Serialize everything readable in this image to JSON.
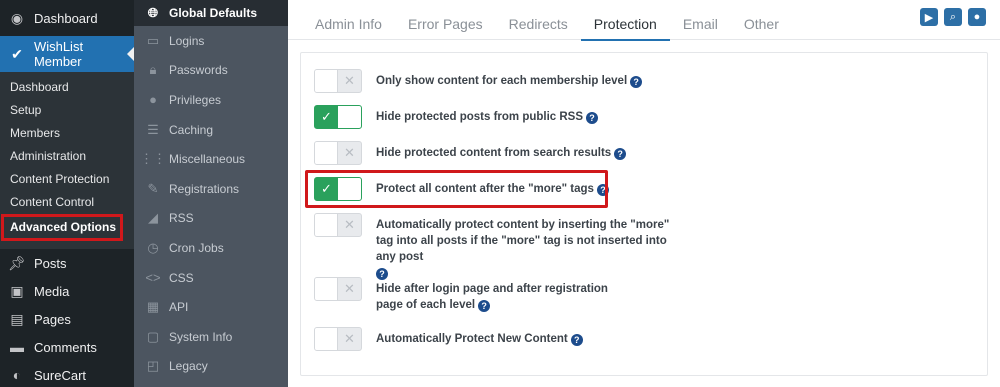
{
  "wp_menu": {
    "dashboard": "Dashboard",
    "wishlist": "WishList Member",
    "submenu": [
      "Dashboard",
      "Setup",
      "Members",
      "Administration",
      "Content Protection",
      "Content Control",
      "Advanced Options"
    ],
    "current_submenu": "Advanced Options",
    "items": [
      {
        "label": "Posts",
        "icon": "pin-icon"
      },
      {
        "label": "Media",
        "icon": "media-icon"
      },
      {
        "label": "Pages",
        "icon": "page-icon"
      },
      {
        "label": "Comments",
        "icon": "comment-icon"
      },
      {
        "label": "SureCart",
        "icon": "surecart-icon"
      }
    ]
  },
  "wl_menu": {
    "items": [
      {
        "label": "Global Defaults",
        "icon": "globe-icon"
      },
      {
        "label": "Logins",
        "icon": "login-icon"
      },
      {
        "label": "Passwords",
        "icon": "lock-icon"
      },
      {
        "label": "Privileges",
        "icon": "user-icon"
      },
      {
        "label": "Caching",
        "icon": "caching-icon"
      },
      {
        "label": "Miscellaneous",
        "icon": "grid-icon"
      },
      {
        "label": "Registrations",
        "icon": "pencil-icon"
      },
      {
        "label": "RSS",
        "icon": "rss-icon"
      },
      {
        "label": "Cron Jobs",
        "icon": "clock-icon"
      },
      {
        "label": "CSS",
        "icon": "code-icon"
      },
      {
        "label": "API",
        "icon": "api-icon"
      },
      {
        "label": "System Info",
        "icon": "info-icon"
      },
      {
        "label": "Legacy",
        "icon": "legacy-icon"
      }
    ],
    "active": "Global Defaults"
  },
  "tabs": [
    "Admin Info",
    "Error Pages",
    "Redirects",
    "Protection",
    "Email",
    "Other"
  ],
  "active_tab": "Protection",
  "settings": [
    {
      "label": "Only show content for each membership level",
      "on": false
    },
    {
      "label": "Hide protected posts from public RSS",
      "on": true
    },
    {
      "label": "Hide protected content from search results",
      "on": false
    },
    {
      "label": "Protect all content after the \"more\" tags",
      "on": true
    },
    {
      "label": "Automatically protect content by inserting the \"more\" tag into all posts if the \"more\" tag is not inserted into any post",
      "on": false
    },
    {
      "label": "Hide after login page and after registration page of each level",
      "on": false
    },
    {
      "label": "Automatically Protect New Content",
      "on": false
    }
  ],
  "colors": {
    "accent": "#2271b1",
    "toggle_on": "#2aa15c",
    "highlight": "#d0181b",
    "help": "#1d4c8c"
  }
}
